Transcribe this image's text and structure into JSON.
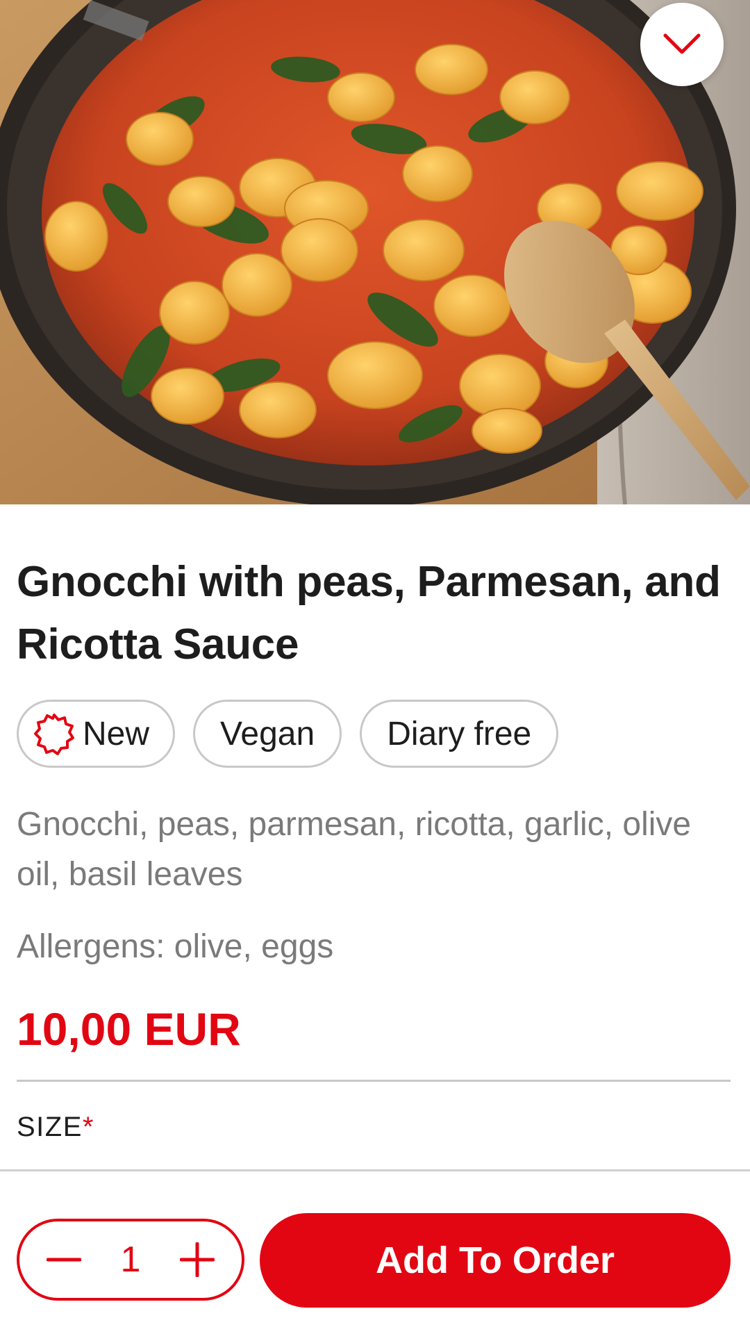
{
  "hero": {
    "image": "gnocchi-pan-photo"
  },
  "header": {
    "collapse_icon": "chevron-down-icon"
  },
  "product": {
    "title": "Gnocchi with peas, Parmesan, and Ricotta Sauce",
    "tags": [
      {
        "label": "New",
        "icon": "starburst-icon"
      },
      {
        "label": "Vegan"
      },
      {
        "label": "Diary free"
      }
    ],
    "ingredients": "Gnocchi, peas, parmesan, ricotta, garlic, olive oil, basil leaves",
    "allergens": "Allergens: olive, eggs",
    "price": "10,00 EUR"
  },
  "options": {
    "size_label": "SIZE",
    "required_marker": "*"
  },
  "order": {
    "quantity": "1",
    "add_label": "Add To Order",
    "minus_icon": "minus-icon",
    "plus_icon": "plus-icon"
  },
  "colors": {
    "accent": "#e20613",
    "muted_text": "#7a7a7a",
    "border": "#c8c8c8"
  }
}
